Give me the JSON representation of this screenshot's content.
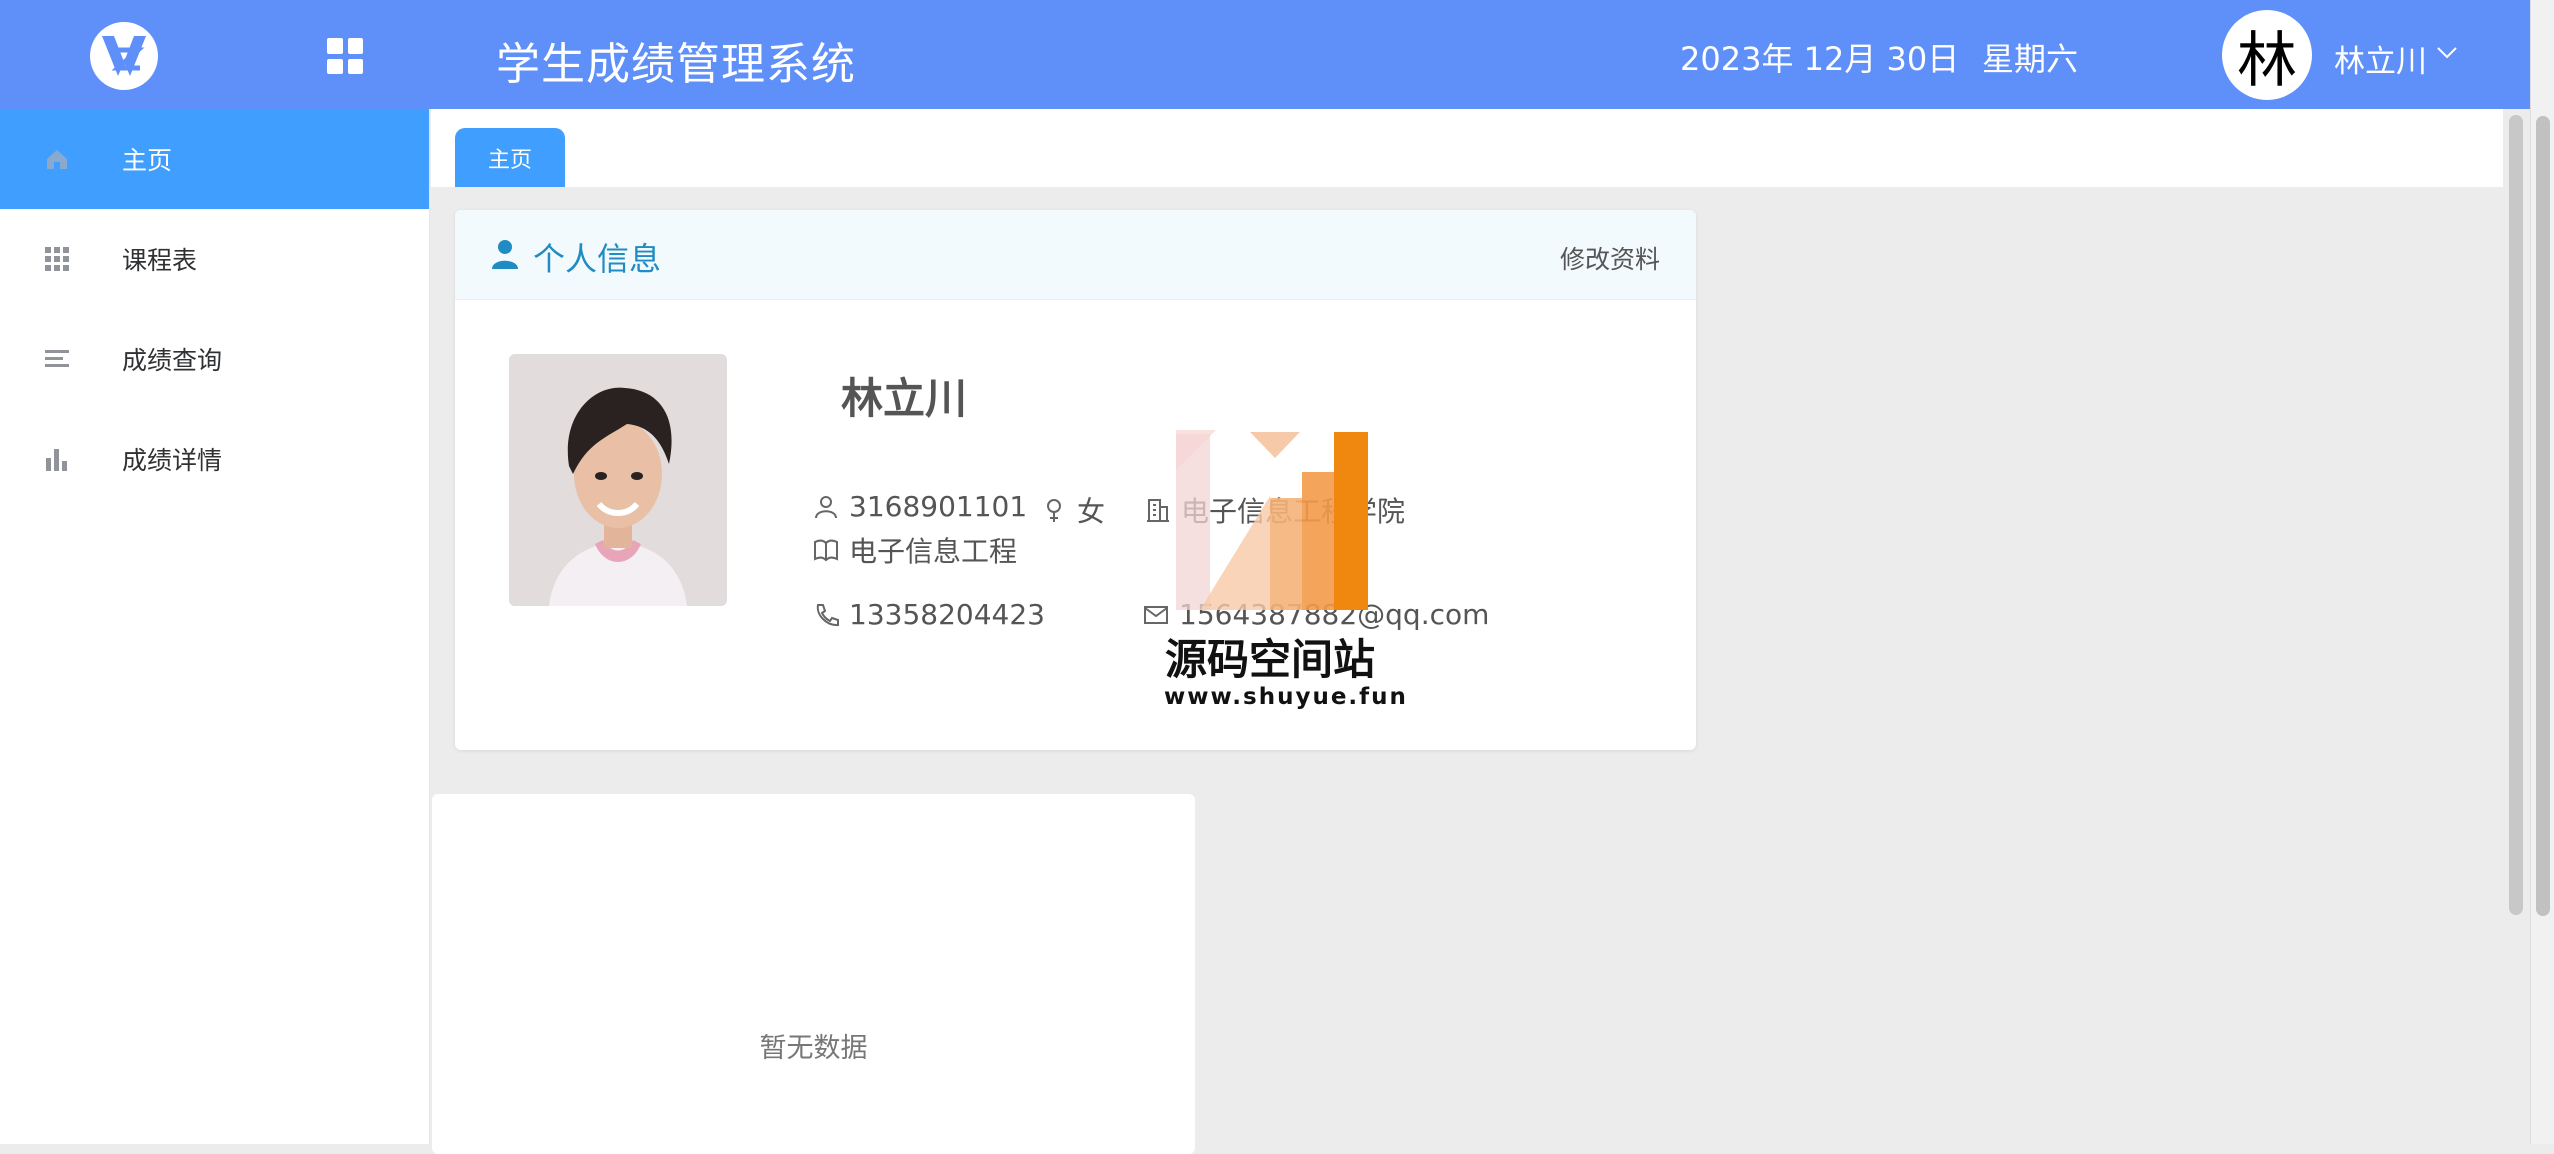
{
  "header": {
    "app_title": "学生成绩管理系统",
    "date": "2023年 12月 30日",
    "weekday": "星期六",
    "avatar_char": "林",
    "user_name": "林立川",
    "background_color": "#5f8ff9"
  },
  "sidebar": {
    "items": [
      {
        "label": "主页",
        "icon": "home-icon",
        "active": true
      },
      {
        "label": "课程表",
        "icon": "grid-icon"
      },
      {
        "label": "成绩查询",
        "icon": "list-icon"
      },
      {
        "label": "成绩详情",
        "icon": "bar-chart-icon"
      }
    ],
    "active_color": "#409eff"
  },
  "tabs": [
    {
      "label": "主页"
    }
  ],
  "profile": {
    "title": "个人信息",
    "edit_label": "修改资料",
    "name": "林立川",
    "student_id": "3168901101",
    "gender": "女",
    "college": "电子信息工程学院",
    "major": "电子信息工程",
    "phone": "13358204423",
    "email": "1564387882@qq.com"
  },
  "watermark": {
    "title": "源码空间站",
    "url": "www.shuyue.fun"
  },
  "empty_panel": {
    "text": "暂无数据"
  }
}
